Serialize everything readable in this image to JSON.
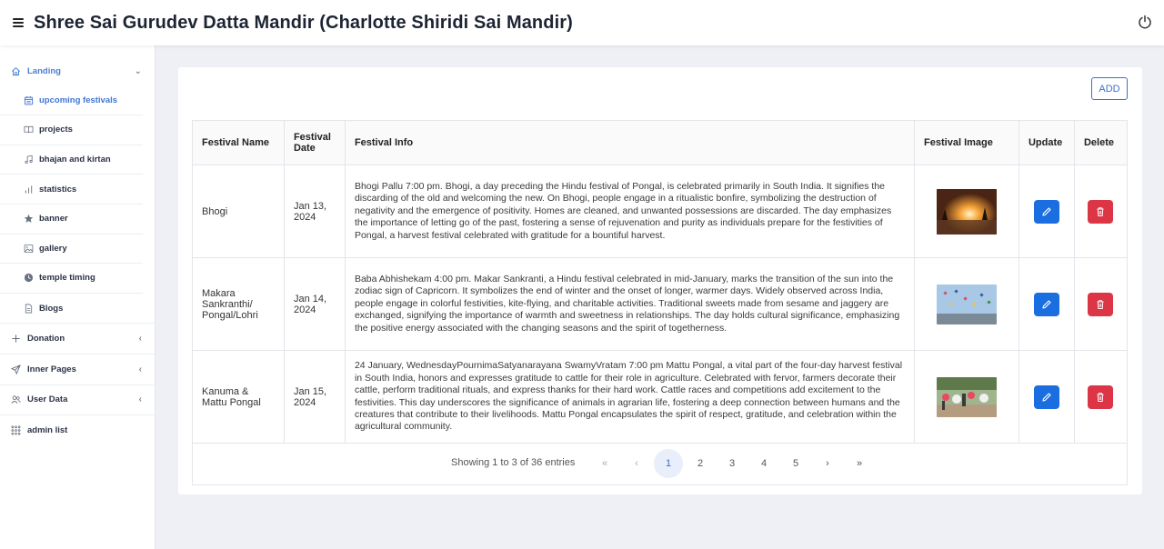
{
  "header": {
    "title": "Shree Sai Gurudev Datta Mandir (Charlotte Shiridi Sai Mandir)"
  },
  "sidebar": {
    "landing": {
      "label": "Landing"
    },
    "sub_items": [
      {
        "label": "upcoming festivals",
        "icon": "calendar-icon"
      },
      {
        "label": "projects",
        "icon": "book-icon"
      },
      {
        "label": "bhajan and kirtan",
        "icon": "music-icon"
      },
      {
        "label": "statistics",
        "icon": "bar-chart-icon"
      },
      {
        "label": "banner",
        "icon": "star-icon"
      },
      {
        "label": "gallery",
        "icon": "image-icon"
      },
      {
        "label": "temple timing",
        "icon": "clock-icon"
      },
      {
        "label": "Blogs",
        "icon": "file-icon"
      }
    ],
    "donation": {
      "label": "Donation"
    },
    "inner_pages": {
      "label": "Inner Pages"
    },
    "user_data": {
      "label": "User Data"
    },
    "admin_list": {
      "label": "admin list"
    }
  },
  "toolbar": {
    "add_label": "ADD"
  },
  "table": {
    "columns": [
      "Festival Name",
      "Festival Date",
      "Festival Info",
      "Festival Image",
      "Update",
      "Delete"
    ],
    "rows": [
      {
        "name": "Bhogi",
        "date": "Jan 13, 2024",
        "info": "Bhogi Pallu 7:00 pm. Bhogi, a day preceding the Hindu festival of Pongal, is celebrated primarily in South India. It signifies the discarding of the old and welcoming the new. On Bhogi, people engage in a ritualistic bonfire, symbolizing the destruction of negativity and the emergence of positivity. Homes are cleaned, and unwanted possessions are discarded. The day emphasizes the importance of letting go of the past, fostering a sense of rejuvenation and purity as individuals prepare for the festivities of Pongal, a harvest festival celebrated with gratitude for a bountiful harvest."
      },
      {
        "name": "Makara Sankranthi/ Pongal/Lohri",
        "date": "Jan 14, 2024",
        "info": "Baba Abhishekam 4:00 pm. Makar Sankranti, a Hindu festival celebrated in mid-January, marks the transition of the sun into the zodiac sign of Capricorn. It symbolizes the end of winter and the onset of longer, warmer days. Widely observed across India, people engage in colorful festivities, kite-flying, and charitable activities. Traditional sweets made from sesame and jaggery are exchanged, signifying the importance of warmth and sweetness in relationships. The day holds cultural significance, emphasizing the positive energy associated with the changing seasons and the spirit of togetherness."
      },
      {
        "name": "Kanuma & Mattu Pongal",
        "date": "Jan 15, 2024",
        "info": "24 January, WednesdayPournimaSatyanarayana SwamyVratam 7:00 pm Mattu Pongal, a vital part of the four-day harvest festival in South India, honors and expresses gratitude to cattle for their role in agriculture. Celebrated with fervor, farmers decorate their cattle, perform traditional rituals, and express thanks for their hard work. Cattle races and competitions add excitement to the festivities. This day underscores the significance of animals in agrarian life, fostering a deep connection between humans and the creatures that contribute to their livelihoods. Mattu Pongal encapsulates the spirit of respect, gratitude, and celebration within the agricultural community."
      }
    ]
  },
  "pagination": {
    "showing": "Showing 1 to 3 of 36 entries",
    "first": "«",
    "prev": "‹",
    "pages": [
      "1",
      "2",
      "3",
      "4",
      "5"
    ],
    "next": "›",
    "last": "»"
  }
}
